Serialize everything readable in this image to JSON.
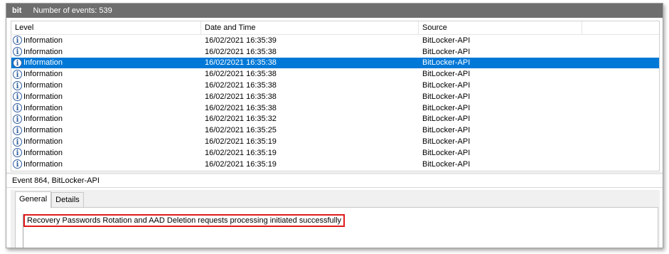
{
  "titlebar": {
    "log_name": "bit",
    "event_count": "Number of events: 539"
  },
  "grid": {
    "columns": [
      "Level",
      "Date and Time",
      "Source",
      ""
    ],
    "rows": [
      {
        "level": "Information",
        "date": "16/02/2021 16:35:39",
        "source": "BitLocker-API"
      },
      {
        "level": "Information",
        "date": "16/02/2021 16:35:38",
        "source": "BitLocker-API"
      },
      {
        "level": "Information",
        "date": "16/02/2021 16:35:38",
        "source": "BitLocker-API"
      },
      {
        "level": "Information",
        "date": "16/02/2021 16:35:38",
        "source": "BitLocker-API"
      },
      {
        "level": "Information",
        "date": "16/02/2021 16:35:38",
        "source": "BitLocker-API"
      },
      {
        "level": "Information",
        "date": "16/02/2021 16:35:38",
        "source": "BitLocker-API"
      },
      {
        "level": "Information",
        "date": "16/02/2021 16:35:38",
        "source": "BitLocker-API"
      },
      {
        "level": "Information",
        "date": "16/02/2021 16:35:32",
        "source": "BitLocker-API"
      },
      {
        "level": "Information",
        "date": "16/02/2021 16:35:25",
        "source": "BitLocker-API"
      },
      {
        "level": "Information",
        "date": "16/02/2021 16:35:19",
        "source": "BitLocker-API"
      },
      {
        "level": "Information",
        "date": "16/02/2021 16:35:19",
        "source": "BitLocker-API"
      },
      {
        "level": "Information",
        "date": "16/02/2021 16:35:19",
        "source": "BitLocker-API"
      }
    ],
    "selected_row_index": 2,
    "level_icon": "information-icon",
    "info_glyph": "i"
  },
  "detail": {
    "header": "Event 864, BitLocker-API",
    "tabs": [
      "General",
      "Details"
    ],
    "active_tab": "General",
    "message": "Recovery Passwords Rotation and AAD Deletion requests processing initiated successfully"
  },
  "colors": {
    "selection": "#0078d7",
    "highlight_border": "#e01b1b",
    "titlebar": "#6e6e6e"
  }
}
